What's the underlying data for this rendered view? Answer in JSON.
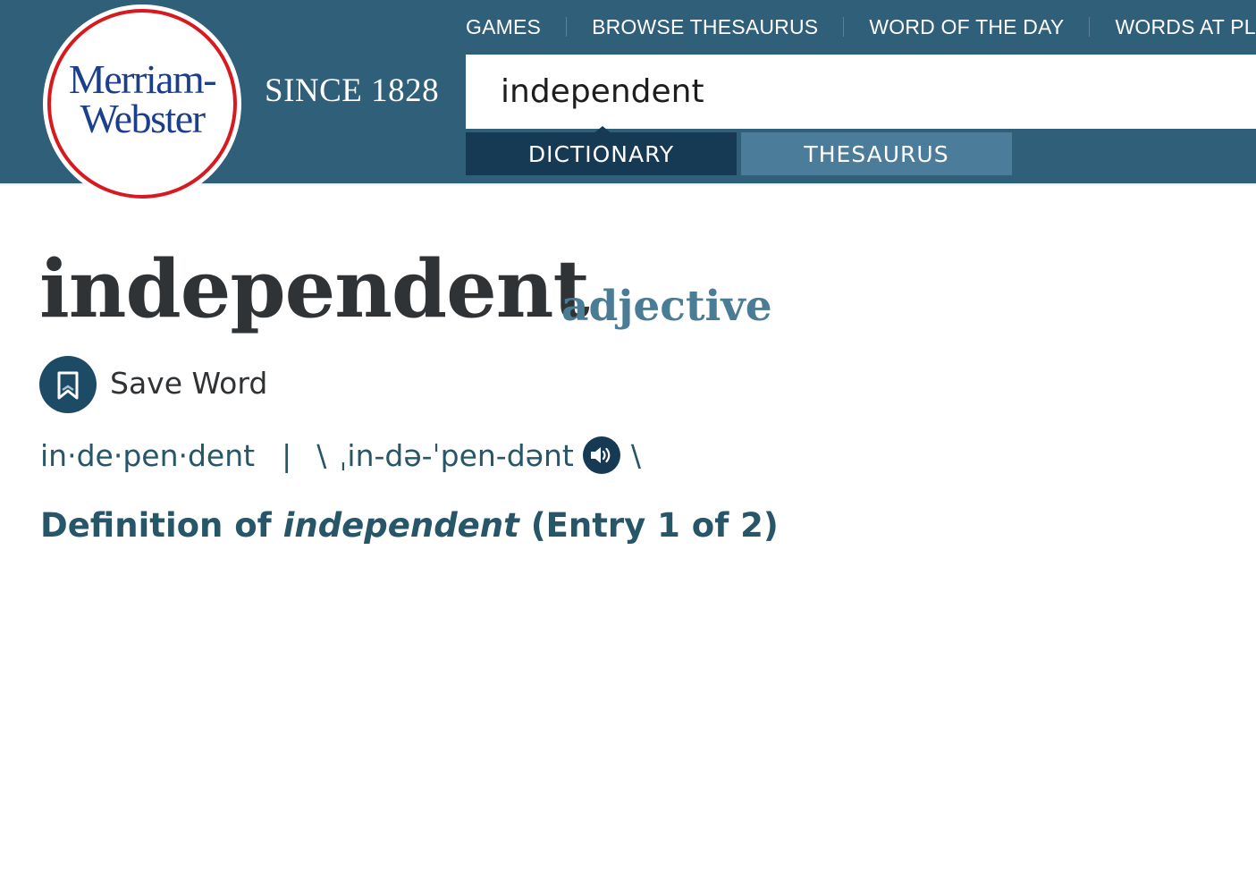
{
  "brand": {
    "logo_line1": "Merriam-",
    "logo_line2": "Webster",
    "since": "SINCE 1828",
    "colors": {
      "header_bg": "#305f7a",
      "logo_ring": "#d71920",
      "logo_text": "#1b3f8b",
      "tab_active": "#163a54",
      "tab_inactive": "#4b7c9a"
    }
  },
  "topnav": {
    "items": [
      "GAMES",
      "BROWSE THESAURUS",
      "WORD OF THE DAY",
      "WORDS AT PLAY"
    ]
  },
  "search": {
    "value": "independent"
  },
  "tabs": {
    "dictionary": "DICTIONARY",
    "thesaurus": "THESAURUS",
    "active": "dictionary"
  },
  "entry": {
    "headword": "independent",
    "part_of_speech": "adjective",
    "save_label": "Save Word",
    "save_icon": "bookmark-icon",
    "syllables": "in·de·pen·dent",
    "separator": "|",
    "slash_open": "\\",
    "pronunciation": "ˌin-də-ˈpen-dənt",
    "slash_close": "\\",
    "audio_icon": "speaker-icon",
    "definition_prefix": "Definition of ",
    "definition_word": "independent",
    "definition_suffix": " (Entry 1 of 2)"
  }
}
